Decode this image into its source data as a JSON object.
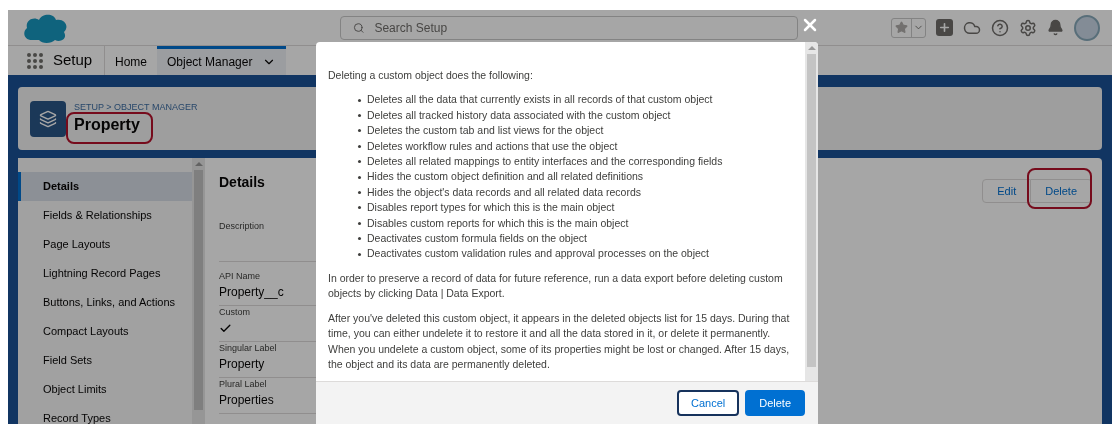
{
  "header": {
    "search_placeholder": "Search Setup"
  },
  "nav": {
    "app_name": "Setup",
    "tabs": [
      {
        "label": "Home",
        "selected": false
      },
      {
        "label": "Object Manager",
        "selected": true
      }
    ]
  },
  "page_header": {
    "breadcrumb": "SETUP > OBJECT MANAGER",
    "title": "Property",
    "title_highlighted": true
  },
  "sidebar": {
    "items": [
      {
        "label": "Details",
        "selected": true
      },
      {
        "label": "Fields & Relationships",
        "selected": false
      },
      {
        "label": "Page Layouts",
        "selected": false
      },
      {
        "label": "Lightning Record Pages",
        "selected": false
      },
      {
        "label": "Buttons, Links, and Actions",
        "selected": false
      },
      {
        "label": "Compact Layouts",
        "selected": false
      },
      {
        "label": "Field Sets",
        "selected": false
      },
      {
        "label": "Object Limits",
        "selected": false
      },
      {
        "label": "Record Types",
        "selected": false
      }
    ]
  },
  "details": {
    "heading": "Details",
    "fields": [
      {
        "kind": "text",
        "label": "Description"
      },
      {
        "kind": "text",
        "label": "API Name",
        "value": "Property__c"
      },
      {
        "kind": "checkbox",
        "label": "Custom",
        "checked": true
      },
      {
        "kind": "text",
        "label": "Singular Label",
        "value": "Property"
      },
      {
        "kind": "text",
        "label": "Plural Label",
        "value": "Properties"
      }
    ],
    "actions": [
      {
        "label": "Edit",
        "highlighted": false
      },
      {
        "label": "Delete",
        "highlighted": true
      }
    ]
  },
  "modal": {
    "intro": "Deleting a custom object does the following:",
    "bullets": [
      "Deletes all the data that currently exists in all records of that custom object",
      "Deletes all tracked history data associated with the custom object",
      "Deletes the custom tab and list views for the object",
      "Deletes workflow rules and actions that use the object",
      "Deletes all related mappings to entity interfaces and the corresponding fields",
      "Hides the custom object definition and all related definitions",
      "Hides the object's data records and all related data records",
      "Disables report types for which this is the main object",
      "Disables custom reports for which this is the main object",
      "Deactivates custom formula fields on the object",
      "Deactivates custom validation rules and approval processes on the object"
    ],
    "paragraphs": [
      "In order to preserve a record of data for future reference, run a data export before deleting custom objects by clicking Data | Data Export.",
      "After you've deleted this custom object, it appears in the deleted objects list for 15 days. During that time, you can either undelete it to restore it and all the data stored in it, or delete it permanently. When you undelete a custom object, some of its properties might be lost or changed. After 15 days, the object and its data are permanently deleted."
    ],
    "buttons": [
      {
        "label": "Cancel",
        "kind": "neutral"
      },
      {
        "label": "Delete",
        "kind": "brand"
      }
    ]
  }
}
